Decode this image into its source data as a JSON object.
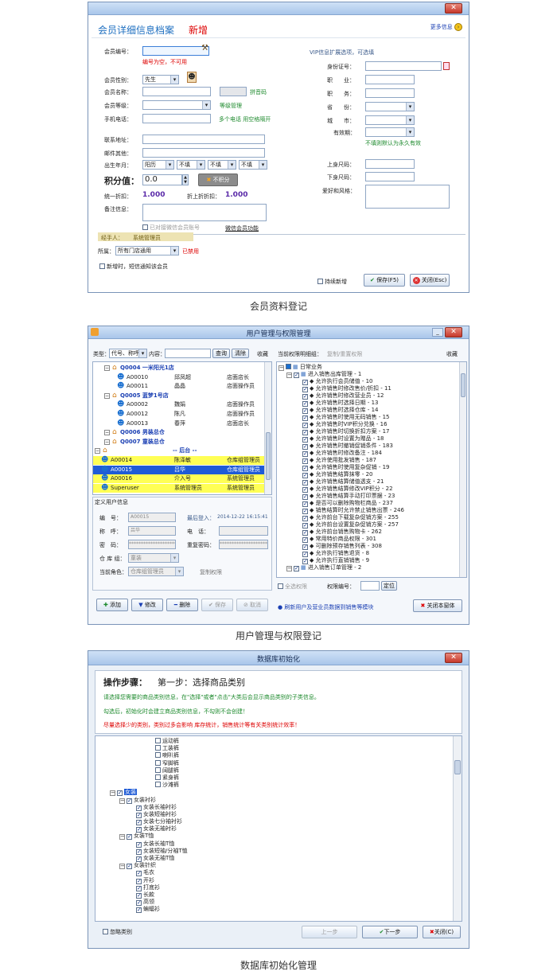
{
  "captions": {
    "w1": "会员资料登记",
    "w2": "用户管理与权限登记",
    "w3": "数据库初始化管理"
  },
  "colors": {
    "title_blue": "#1e6fc0",
    "red": "#d00000",
    "green": "#1d8a2d",
    "highlight": "#ffff55"
  },
  "member": {
    "header_title": "会员详细信息档案",
    "header_new": "新增",
    "more_info": "更多信息",
    "left": {
      "member_no_label": "会员编号：",
      "member_no_note": "编号为空，不可用",
      "gender_label": "会员性别：",
      "gender_value": "先生",
      "name_label": "会员名称：",
      "pinyin_note": "拼音码",
      "level_label": "会员等级：",
      "level_note": "等级管理",
      "phone_label": "手机电话：",
      "phone_note": "多个电话 用空格隔开",
      "address_label": "联系地址：",
      "email_label": "邮件其他：",
      "birth_label": "出生年月：",
      "birth_type": "阳历",
      "birth_y": "不填",
      "birth_m": "不填",
      "birth_d": "不填",
      "points_label": "积分值：",
      "points_value": "0.0",
      "points_btn": "不积分",
      "discount_label": "统一折扣：",
      "discount_value": "1.000",
      "discount2_label": "折上折折扣：",
      "discount2_value": "1.000",
      "remark_label": "备注信息：",
      "wechat_bound": "已对接微信会员账号",
      "wechat_func": "微信会员功能",
      "handler_label": "经手人：",
      "handler_value": "系统管理员",
      "store_label": "所属：",
      "store_value": "所有门店通用",
      "store_note": "已禁用",
      "sms_notify": "新增时，短信通知该会员"
    },
    "right": {
      "vip_note": "VIP信息扩展选项，可选填",
      "id_label": "身份证号：",
      "job_label": "职　　业：",
      "duty_label": "职　　务：",
      "province_label": "省　　份：",
      "city_label": "城　　市：",
      "valid_label": "有效期：",
      "valid_note": "不填则默认为永久有效",
      "top_size_label": "上身尺码：",
      "bottom_size_label": "下身尺码：",
      "hobby_label": "爱好和风格："
    },
    "buttons": {
      "continue": "持续新增",
      "save": "保存(F5)",
      "close": "关闭(Esc)"
    }
  },
  "users": {
    "title": "用户管理与权限管理",
    "filter": {
      "type_label": "类型：",
      "type_value": "代号、称呼",
      "content_label": "内容：",
      "query": "查询",
      "clear": "清除",
      "fav": "收藏"
    },
    "tree": [
      {
        "code": "Q0004 一米阳光1店",
        "kind": "store"
      },
      {
        "code": "A00010",
        "name": "邱凤超",
        "role": "店面店长",
        "kind": "user"
      },
      {
        "code": "A00011",
        "name": "晶晶",
        "role": "店面操作员",
        "kind": "user"
      },
      {
        "code": "Q0005 蓝梦1号店",
        "kind": "store"
      },
      {
        "code": "A00002",
        "name": "魏娟",
        "role": "店面操作员",
        "kind": "user"
      },
      {
        "code": "A00012",
        "name": "陈凡",
        "role": "店面操作员",
        "kind": "user"
      },
      {
        "code": "A00013",
        "name": "春萍",
        "role": "店面店长",
        "kind": "user"
      },
      {
        "code": "Q0006 男装总仓",
        "kind": "store"
      },
      {
        "code": "Q0007 童装总仓",
        "kind": "store"
      },
      {
        "code": "-- 后台 --",
        "kind": "group"
      },
      {
        "code": "A00014",
        "name": "陈泽敏",
        "role": "仓库组管理员",
        "kind": "hl"
      },
      {
        "code": "A00015",
        "name": "吕华",
        "role": "仓库组管理员",
        "kind": "sel"
      },
      {
        "code": "A00016",
        "name": "介入号",
        "role": "系统管理员",
        "kind": "hl"
      },
      {
        "code": "Superuser",
        "name": "系统管理员",
        "role": "系统管理员",
        "kind": "hl"
      }
    ],
    "form": {
      "section": "定义用户信息",
      "no_label": "编　号：",
      "no_value": "A00015",
      "login_label": "最后登入：",
      "login_value": "2014-12-22 16:15:41",
      "call_label": "称　呼：",
      "call_value": "吕华",
      "phone_label": "电　话：",
      "pwd_label": "密　码：",
      "pwd_value": "********************",
      "repwd_label": "重复密码：",
      "repwd_value": "********************",
      "wh_label": "仓 库 组：",
      "wh_value": "童装",
      "role_label": "当前角色：",
      "role_value": "仓库组管理员",
      "copy_perm": "复制权限"
    },
    "bottom": {
      "add": "添加",
      "edit": "修改",
      "del": "删除",
      "save": "保存",
      "cancel": "取消"
    },
    "perm": {
      "title": "当前权限明细组：",
      "copy": "复制/重置权限",
      "fav": "收藏",
      "root": "日常业务",
      "group1": "进入销售出库管理 - 1",
      "items": [
        "允许执行会员储值 - 10",
        "允许销售时修改售价/折扣 - 11",
        "允许销售时修改营业员 - 12",
        "允许销售时选择日期 - 13",
        "允许销售时选择仓库 - 14",
        "允许销售时使用无码销售 - 15",
        "允许销售时VIP积分兑换 - 16",
        "允许销售时切换折扣方案 - 17",
        "允许销售时设置为赠品 - 18",
        "允许销售时撤销促销条件 - 183",
        "允许销售时修改备注 - 184",
        "允许使用批发销售 - 187",
        "允许销售时使用复杂促销 - 19",
        "允许销售结算抹零 - 20",
        "允许销售结算储值透支 - 21",
        "允许销售结算修改VIP积分 - 22",
        "允许销售结算手动打印票据 - 23",
        "是否可以删除购物栏商品 - 237",
        "销售结算时允许禁止销售出票 - 246",
        "允许前台下载复杂促销方案 - 255",
        "允许前台设置复杂促销方案 - 257",
        "允许前台销售购物卡 - 262",
        "常用特价商品权限 - 301",
        "可删除预存销售列表 - 308",
        "允许执行销售退货 - 8",
        "允许执行直销销售 - 9"
      ],
      "group2": "进入销售订单管理 - 2",
      "select_all": "全选权限",
      "perm_no_label": "权限编号：",
      "locate": "定位",
      "refresh_note": "刷新用户及营业员数据到销售等模块",
      "close": "关闭本窗体"
    }
  },
  "dbinit": {
    "title": "数据库初始化",
    "step_label": "操作步骤：",
    "step_text": "第一步：选择商品类别",
    "line1": "请选择您需要的商品类别信息，在\"选择\"或者\"点击\"大类后会显示商品类别的子类信息。",
    "line2": "勾选后，初始化时会建立商品类别信息，不勾则不会创建！",
    "line3": "尽量选择少的类别，类别过多会影响 库存统计，销售统计等有关类别统计效率！",
    "tree": [
      {
        "label": "运动裤",
        "indent": 4,
        "checked": false
      },
      {
        "label": "工装裤",
        "indent": 4,
        "checked": false
      },
      {
        "label": "喇叭裤",
        "indent": 4,
        "checked": false
      },
      {
        "label": "窄脚裤",
        "indent": 4,
        "checked": false
      },
      {
        "label": "阔腿裤",
        "indent": 4,
        "checked": false
      },
      {
        "label": "紧身裤",
        "indent": 4,
        "checked": false
      },
      {
        "label": "沙滩裤",
        "indent": 4,
        "checked": false
      },
      {
        "label": "女装",
        "indent": 0,
        "checked": true,
        "sel": true,
        "exp": true
      },
      {
        "label": "女装衬衫",
        "indent": 1,
        "checked": true,
        "exp": true
      },
      {
        "label": "女装长袖衬衫",
        "indent": 2,
        "checked": true
      },
      {
        "label": "女装短袖衬衫",
        "indent": 2,
        "checked": true
      },
      {
        "label": "女装七分袖衬衫",
        "indent": 2,
        "checked": true
      },
      {
        "label": "女装无袖衬衫",
        "indent": 2,
        "checked": true
      },
      {
        "label": "女装T恤",
        "indent": 1,
        "checked": true,
        "exp": true
      },
      {
        "label": "女装长袖T恤",
        "indent": 2,
        "checked": true
      },
      {
        "label": "女装短袖/分袖T恤",
        "indent": 2,
        "checked": true
      },
      {
        "label": "女装无袖T恤",
        "indent": 2,
        "checked": true
      },
      {
        "label": "女装针织",
        "indent": 1,
        "checked": true,
        "exp": true
      },
      {
        "label": "毛衣",
        "indent": 2,
        "checked": true
      },
      {
        "label": "开衫",
        "indent": 2,
        "checked": true
      },
      {
        "label": "打底衫",
        "indent": 2,
        "checked": true
      },
      {
        "label": "长款",
        "indent": 2,
        "checked": true
      },
      {
        "label": "高领",
        "indent": 2,
        "checked": true
      },
      {
        "label": "蝙蝠衫",
        "indent": 2,
        "checked": true
      }
    ],
    "ignore": "忽略类别",
    "prev": "上一步",
    "next": "下一步",
    "close": "关闭(C)"
  }
}
